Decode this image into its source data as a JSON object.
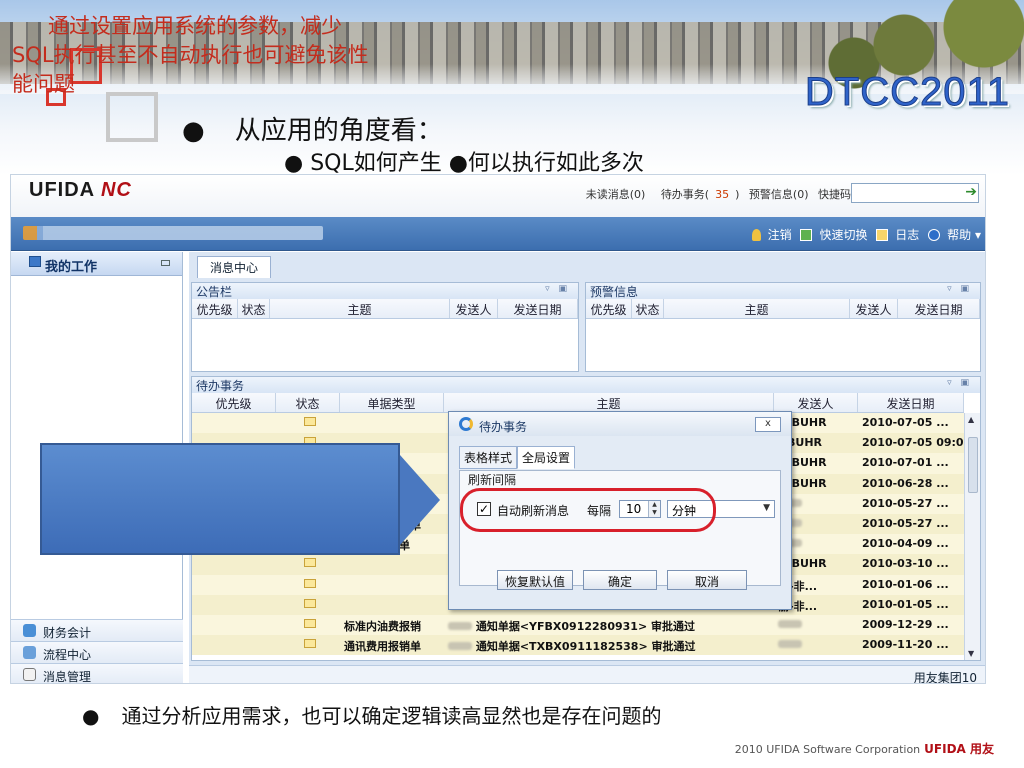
{
  "slide": {
    "badge": "DTCC2011",
    "bullet1": "从应用的角度看：",
    "bullet2": "● SQL如何产生  ●何以执行如此多次",
    "bullet_dot": "●",
    "callout": "通过设置应用系统的参数，减少SQL执行甚至不自动执行也可避免该性能问题",
    "bottom_bullet": "通过分析应用需求，也可以确定逻辑读高显然也是存在问题的",
    "footer_text": "2010 UFIDA Software Corporation",
    "footer_brand": "UFIDA 用友"
  },
  "app": {
    "logo": "UFIDA",
    "logo_nc": "NC",
    "messages": [
      {
        "label": "未读消息(0)",
        "count": ""
      },
      {
        "label": "待办事务(",
        "count": "35",
        "suffix": ")"
      },
      {
        "label": "预警信息(0)",
        "count": ""
      },
      {
        "label": "快捷码",
        "count": ""
      }
    ],
    "nav_actions": [
      "注销",
      "快速切换",
      "日志",
      "帮助"
    ],
    "sidebar": {
      "title": "我的工作",
      "items": [
        "财务会计",
        "流程中心",
        "消息管理"
      ]
    },
    "tab": "消息中心",
    "bulletin": {
      "title": "公告栏",
      "columns": [
        "优先级",
        "状态",
        "主题",
        "发送人",
        "发送日期"
      ]
    },
    "alerts": {
      "title": "预警信息",
      "columns": [
        "优先级",
        "状态",
        "主题",
        "发送人",
        "发送日期"
      ]
    },
    "todo": {
      "title": "待办事务",
      "columns": [
        "优先级",
        "状态",
        "单据类型",
        "主题",
        "发送人",
        "发送日期"
      ],
      "rows": [
        {
          "type": "",
          "subject": "",
          "sender": "-GBUHR",
          "date": "2010-07-05 ..."
        },
        {
          "type": "",
          "subject": "",
          "sender": "GBUHR",
          "date": "2010-07-05 09:0..."
        },
        {
          "type": "",
          "subject": "",
          "sender": "-GBUHR",
          "date": "2010-07-01 ..."
        },
        {
          "type": "费用报销单",
          "subject": "",
          "sender": "-GBUHR",
          "date": "2010-06-28 ..."
        },
        {
          "type": "通讯费用报销单",
          "subject": "",
          "sender": "",
          "date": "2010-05-27 ..."
        },
        {
          "type": "通讯费用报销单",
          "subject": "",
          "sender": "",
          "date": "2010-05-27 ..."
        },
        {
          "type": "差旅费报销单",
          "subject": "",
          "sender": "",
          "date": "2010-04-09 ..."
        },
        {
          "type": "",
          "subject": "",
          "sender": "-GBUHR",
          "date": "2010-03-10 ..."
        },
        {
          "type": "",
          "subject": "",
          "sender": "丽-非...",
          "date": "2010-01-06 ..."
        },
        {
          "type": "",
          "subject": "",
          "sender": "丽-非...",
          "date": "2010-01-05 ..."
        },
        {
          "type": "标准内油费报销",
          "subject": "通知单据<YFBX0912280931> 审批通过",
          "sender": "",
          "date": "2009-12-29 ..."
        },
        {
          "type": "通讯费用报销单",
          "subject": "通知单据<TXBX0911182538> 审批通过",
          "sender": "",
          "date": "2009-11-20 ..."
        }
      ]
    },
    "status_text": "用友集团10",
    "dialog": {
      "title": "待办事务",
      "close": "x",
      "tabs": [
        "表格样式",
        "全局设置"
      ],
      "group": "刷新间隔",
      "check_mark": "✓",
      "auto_refresh": "自动刷新消息",
      "every": "每隔",
      "interval": "10",
      "unit": "分钟",
      "buttons": [
        "恢复默认值",
        "确定",
        "取消"
      ]
    }
  }
}
